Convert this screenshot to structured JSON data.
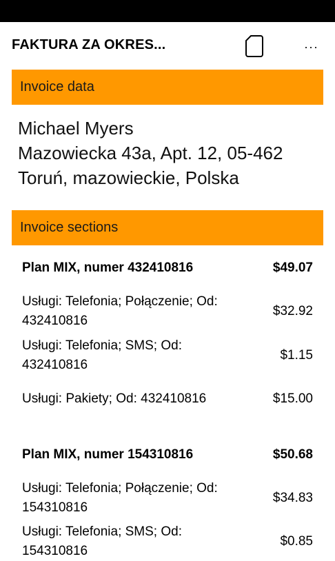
{
  "app_bar": {
    "title": "FAKTURA ZA OKRES...",
    "doc_icon": "document-icon",
    "more_label": "..."
  },
  "invoice_data": {
    "header": "Invoice data",
    "address": [
      "Michael Myers",
      "Mazowiecka 43a, Apt. 12, 05-462",
      "Toruń, mazowieckie, Polska"
    ]
  },
  "invoice_sections": {
    "header": "Invoice sections",
    "plans": [
      {
        "name": "Plan MIX, numer 432410816",
        "total": "$49.07",
        "items": [
          {
            "desc": "Usługi: Telefonia; Połączenie; Od: 432410816",
            "amount": "$32.92"
          },
          {
            "desc": "Usługi: Telefonia; SMS; Od: 432410816",
            "amount": "$1.15"
          },
          {
            "desc": "Usługi: Pakiety; Od: 432410816",
            "amount": "$15.00"
          }
        ]
      },
      {
        "name": "Plan MIX, numer 154310816",
        "total": "$50.68",
        "items": [
          {
            "desc": "Usługi: Telefonia; Połączenie; Od: 154310816",
            "amount": "$34.83"
          },
          {
            "desc": "Usługi: Telefonia; SMS; Od: 154310816",
            "amount": "$0.85"
          }
        ]
      }
    ]
  }
}
